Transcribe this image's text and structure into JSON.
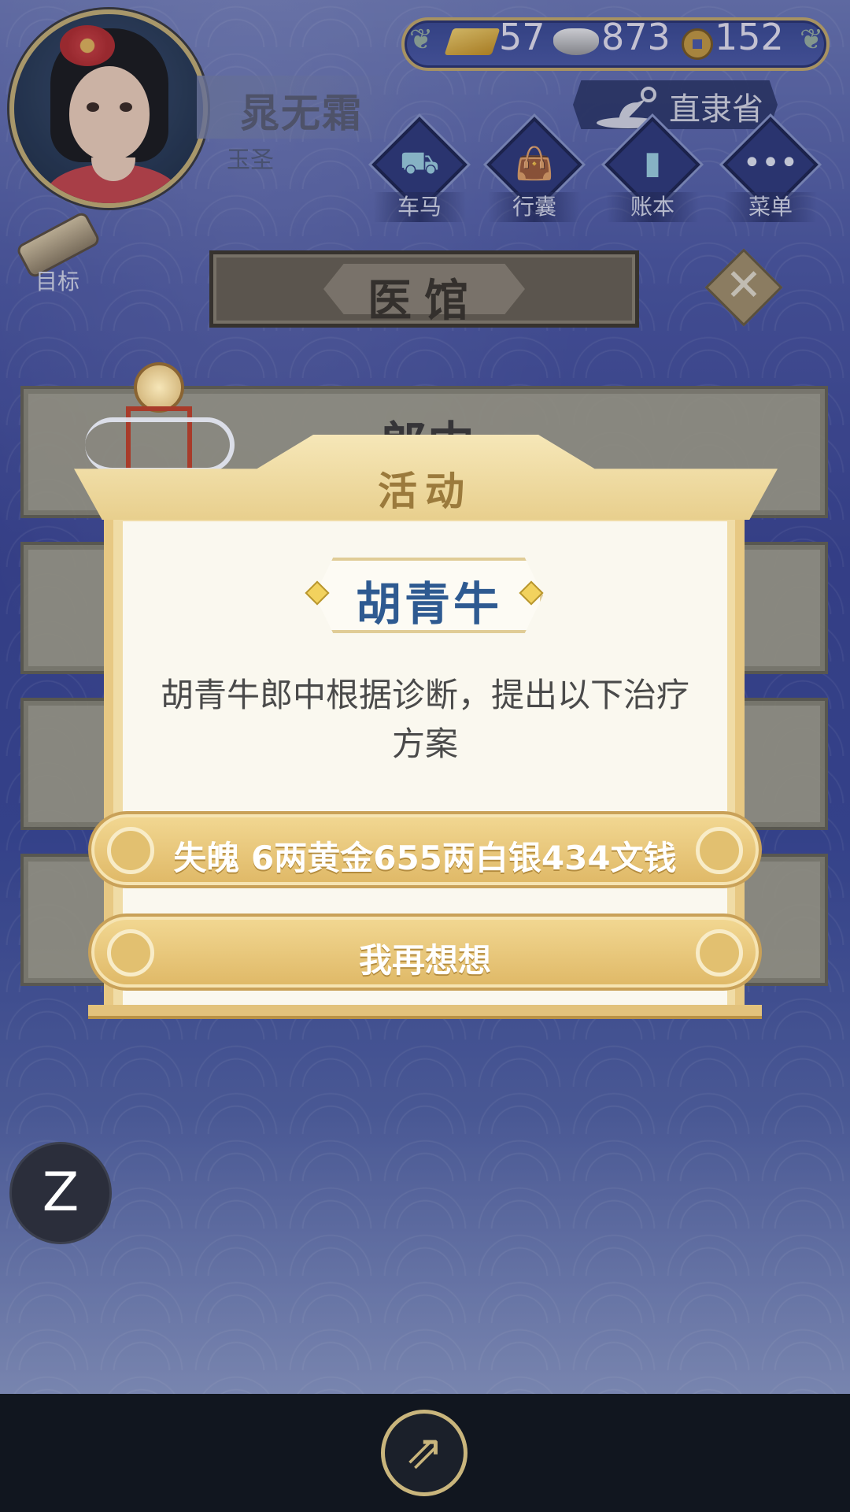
{
  "player": {
    "name": "晁无霜",
    "title": "玉圣"
  },
  "currency": {
    "gold": "57",
    "silver": "873",
    "coins": "152"
  },
  "province": "直隶省",
  "hud_buttons": [
    {
      "label": "车马",
      "icon": "carriage-icon"
    },
    {
      "label": "行囊",
      "icon": "bag-icon"
    },
    {
      "label": "账本",
      "icon": "ledger-icon"
    },
    {
      "label": "菜单",
      "icon": "menu-dots-icon"
    }
  ],
  "goal": {
    "label": "目标",
    "icon": "scroll-icon"
  },
  "page": {
    "title": "医馆"
  },
  "background_list": {
    "first_card_title": "郎中"
  },
  "modal": {
    "title": "活动",
    "npc_name": "胡青牛",
    "description": "胡青牛郎中根据诊断，提出以下治疗方案",
    "options": [
      {
        "label": "失魄 6两黄金655两白银434文钱"
      },
      {
        "label": "我再想想"
      }
    ]
  },
  "fab": {
    "label": "Z"
  },
  "bottom_bar": {
    "share_icon": "share-icon"
  },
  "colors": {
    "background": "#3e4a92",
    "modal_gold": "#e2c070",
    "npc_name": "#2e5a91",
    "header_brown": "#6b6252"
  }
}
